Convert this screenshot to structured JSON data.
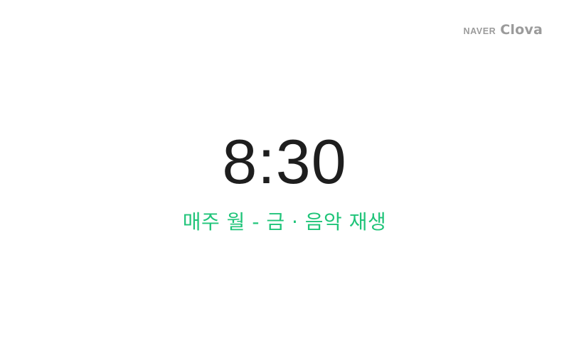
{
  "brand": {
    "naver": "NAVER",
    "clova": "Clova"
  },
  "alarm": {
    "time": "8:30",
    "description": "매주 월 - 금 · 음악 재생"
  },
  "colors": {
    "background": "#ffffff",
    "time_text": "#1e1e1e",
    "description_text": "#1fc479",
    "brand_text": "#9b9b9b"
  }
}
